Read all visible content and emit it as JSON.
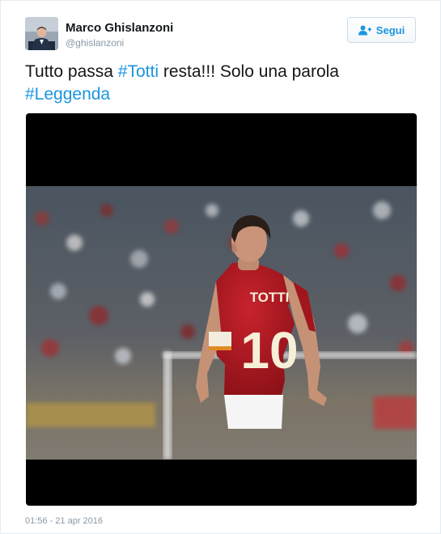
{
  "author": {
    "name": "Marco Ghislanzoni",
    "handle": "@ghislanzoni"
  },
  "follow_button": {
    "label": "Segui",
    "icon": "add-user-icon"
  },
  "tweet": {
    "text_before_tag1": "Tutto passa ",
    "hashtag1": "#Totti",
    "text_after_tag1": " resta!!! Solo una parola",
    "hashtag2": "#Leggenda"
  },
  "photo": {
    "jersey_name": "TOTTI",
    "jersey_number": "10"
  },
  "timestamp": "01:56 - 21 apr 2016",
  "colors": {
    "link": "#1b95e0",
    "jersey": "#b51b25",
    "text": "#14171a",
    "muted": "#8899a6"
  }
}
